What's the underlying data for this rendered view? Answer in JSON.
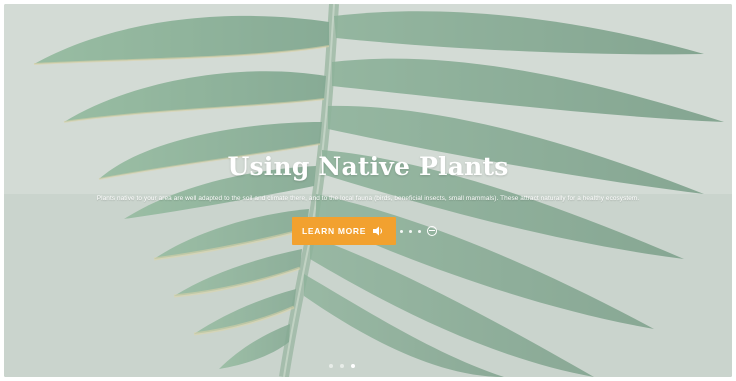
{
  "hero": {
    "title": "Using Native Plants",
    "subtitle": "Plants native to your area are well adapted to the soil and climate there, and to the local fauna (birds, beneficial insects, small mammals). These attract naturally for a healthy ecosystem.",
    "cta_label": "LEARN MORE"
  },
  "colors": {
    "accent": "#f2a12f",
    "leaf": "#3f7a55",
    "overlay": "#e8eae8"
  },
  "icons": {
    "cta_icon": "speaker-icon",
    "trailing_icon": "circle-minus-icon"
  },
  "pager": {
    "slides": 3,
    "active_index": 2
  }
}
